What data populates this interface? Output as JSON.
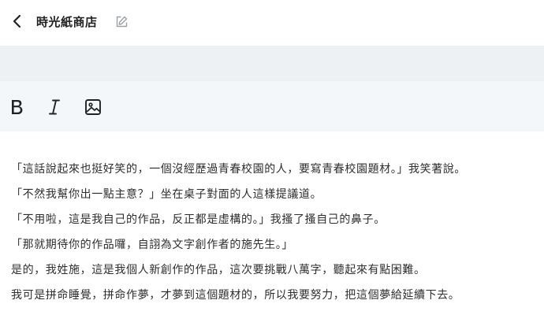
{
  "header": {
    "title": "時光紙商店",
    "back_icon": "chevron-left-icon",
    "edit_icon": "edit-icon"
  },
  "toolbar": {
    "tools": [
      {
        "name": "bold",
        "icon": "bold-icon"
      },
      {
        "name": "italic",
        "icon": "italic-icon"
      },
      {
        "name": "image",
        "icon": "image-icon"
      }
    ]
  },
  "editor": {
    "paragraphs": [
      "「這話說起來也挺好笑的，一個沒經歷過青春校園的人，要寫青春校園題材。」我笑著說。",
      "「不然我幫你出一點主意？」坐在桌子對面的人這樣提議道。",
      "「不用啦，這是我自己的作品，反正都是虛構的。」我搔了搔自己的鼻子。",
      "「那就期待你的作品囉，自詡為文字創作者的施先生。」",
      "是的，我姓施，這是我個人新創作的作品，這次要挑戰八萬字，聽起來有點困難。",
      "我可是拼命睡覺，拼命作夢，才夢到這個題材的，所以我要努力，把這個夢給延續下去。"
    ]
  },
  "colors": {
    "band": "#eef1f4",
    "toolbar_bg": "#f3f7fa",
    "text": "#2e2e2e",
    "icon_gray": "#9aa0a6"
  }
}
